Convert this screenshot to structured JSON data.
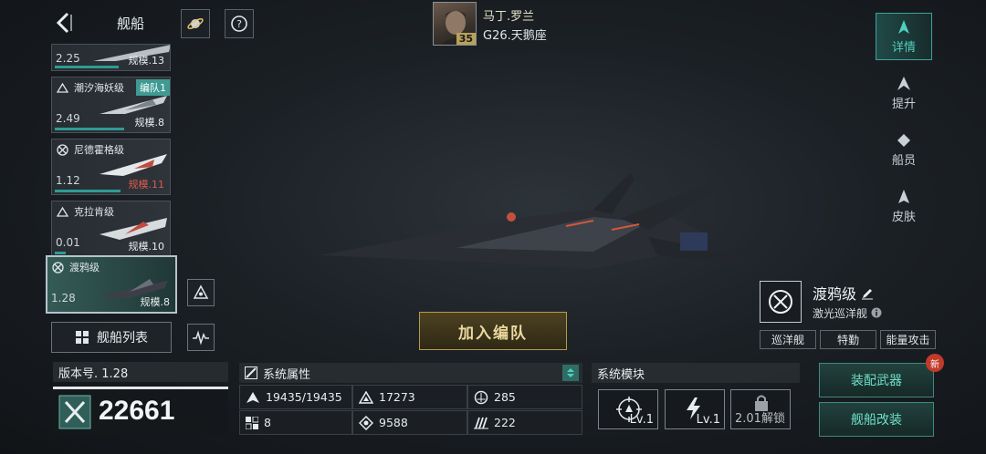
{
  "header": {
    "title": "舰船",
    "back_icon": "back-arrow-icon",
    "planet_icon": "planet-icon",
    "help_icon": "help-icon"
  },
  "captain": {
    "name": "马丁.罗兰",
    "level": "35",
    "location": "G26.天鹅座"
  },
  "ships": [
    {
      "name": "",
      "value": "2.25",
      "scale": "规模.13",
      "scale_color": "white",
      "partial": true
    },
    {
      "name": "潮汐海妖级",
      "value": "2.49",
      "scale": "规模.8",
      "tag": "编队1",
      "icon": "wave-icon"
    },
    {
      "name": "尼德霍格级",
      "value": "1.12",
      "scale": "规模.11",
      "scale_color": "red",
      "icon": "crosshair-icon"
    },
    {
      "name": "克拉肯级",
      "value": "0.01",
      "scale": "规模.10",
      "icon": "wave-icon"
    },
    {
      "name": "渡鸦级",
      "value": "1.28",
      "scale": "规模.8",
      "icon": "crosshair-icon",
      "active": true
    }
  ],
  "ship_list_button": "舰船列表",
  "join_button": "加入编队",
  "right_tabs": [
    {
      "label": "详情",
      "icon": "ship-detail-icon",
      "active": true
    },
    {
      "label": "提升",
      "icon": "upgrade-icon"
    },
    {
      "label": "船员",
      "icon": "crew-icon"
    },
    {
      "label": "皮肤",
      "icon": "skin-icon"
    }
  ],
  "ship_class": {
    "name": "渡鸦级",
    "subtype": "激光巡洋舰",
    "tags": [
      "巡洋舰",
      "特勤",
      "能量攻击"
    ]
  },
  "actions": {
    "equip_weapons": "装配武器",
    "new_badge": "新",
    "modify_ship": "舰船改装"
  },
  "version": {
    "label": "版本号. 1.28",
    "power": "22661"
  },
  "attributes": {
    "title": "系统属性",
    "items": [
      {
        "icon": "hull-icon",
        "value": "19435/19435"
      },
      {
        "icon": "armor-icon",
        "value": "17273"
      },
      {
        "icon": "shield-icon",
        "value": "285"
      },
      {
        "icon": "grid-icon",
        "value": "8"
      },
      {
        "icon": "energy-icon",
        "value": "9588"
      },
      {
        "icon": "speed-icon",
        "value": "222"
      }
    ]
  },
  "modules": {
    "title": "系统模块",
    "items": [
      {
        "icon": "targeting-module-icon",
        "label": "Lv.1"
      },
      {
        "icon": "lightning-module-icon",
        "label": "Lv.1"
      },
      {
        "icon": "lock-icon",
        "label": "2.01解锁"
      }
    ]
  },
  "colors": {
    "accent": "#3aa59b",
    "gold": "#b59a48",
    "red": "#e05a4d"
  }
}
